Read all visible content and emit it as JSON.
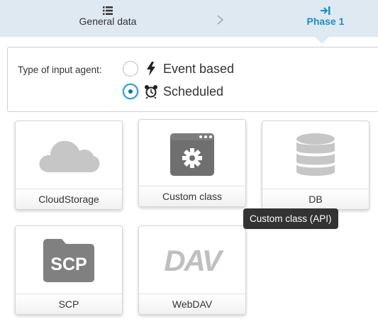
{
  "wizard": {
    "steps": [
      {
        "label": "General data",
        "icon": "list-icon",
        "active": false
      },
      {
        "label": "Phase 1",
        "icon": "step-into-icon",
        "active": true
      }
    ],
    "separator_icon": "chevron-right-icon",
    "colors": {
      "bar": "#dfe9f1",
      "active": "#1e8fbf",
      "inactive": "#333333"
    }
  },
  "input_agent": {
    "label": "Type of input agent:",
    "options": [
      {
        "label": "Event based",
        "icon": "bolt-icon",
        "selected": false
      },
      {
        "label": "Scheduled",
        "icon": "alarm-clock-icon",
        "selected": true
      }
    ],
    "accent_color": "#2a9fd0"
  },
  "tiles": [
    {
      "label": "CloudStorage",
      "icon": "cloud-icon"
    },
    {
      "label": "Custom class",
      "icon": "window-gear-icon"
    },
    {
      "label": "DB",
      "icon": "database-icon"
    },
    {
      "label": "SCP",
      "icon": "scp-folder-icon",
      "icon_text": "SCP"
    },
    {
      "label": "WebDAV",
      "icon": "dav-icon",
      "icon_text": "DAV"
    }
  ],
  "tooltip": {
    "text": "Custom class (API)"
  }
}
